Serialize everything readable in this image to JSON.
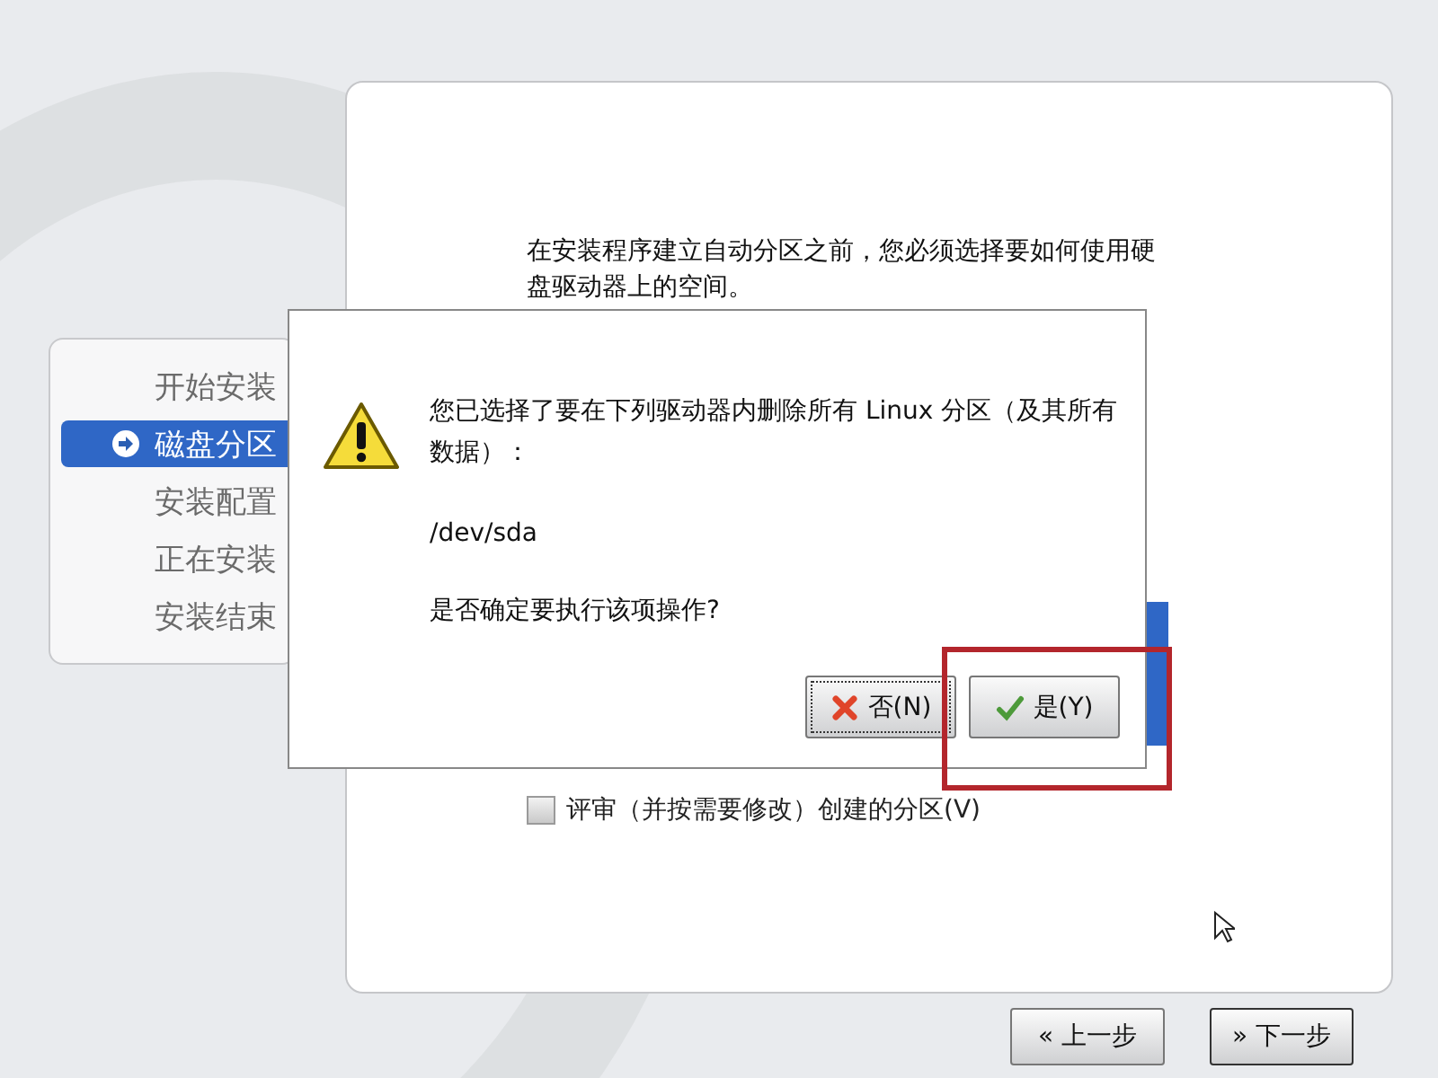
{
  "sidebar": {
    "items": [
      {
        "label": "开始安装",
        "selected": false
      },
      {
        "label": "磁盘分区",
        "selected": true
      },
      {
        "label": "安装配置",
        "selected": false
      },
      {
        "label": "正在安装",
        "selected": false
      },
      {
        "label": "安装结束",
        "selected": false
      }
    ]
  },
  "main": {
    "intro": "在安装程序建立自动分区之前，您必须选择要如何使用硬盘驱动器上的空间。",
    "review_checkbox": {
      "label": "评审（并按需要修改）创建的分区(V)",
      "checked": false
    }
  },
  "dialog": {
    "message": "您已选择了要在下列驱动器内删除所有 Linux 分区（及其所有数据）：",
    "device": "/dev/sda",
    "question": "是否确定要执行该项操作?",
    "buttons": [
      {
        "label": "否(N)",
        "kind": "no"
      },
      {
        "label": "是(Y)",
        "kind": "yes"
      }
    ]
  },
  "nav_buttons": [
    {
      "label": "« 上一步",
      "kind": "back"
    },
    {
      "label": "» 下一步",
      "kind": "next"
    }
  ]
}
